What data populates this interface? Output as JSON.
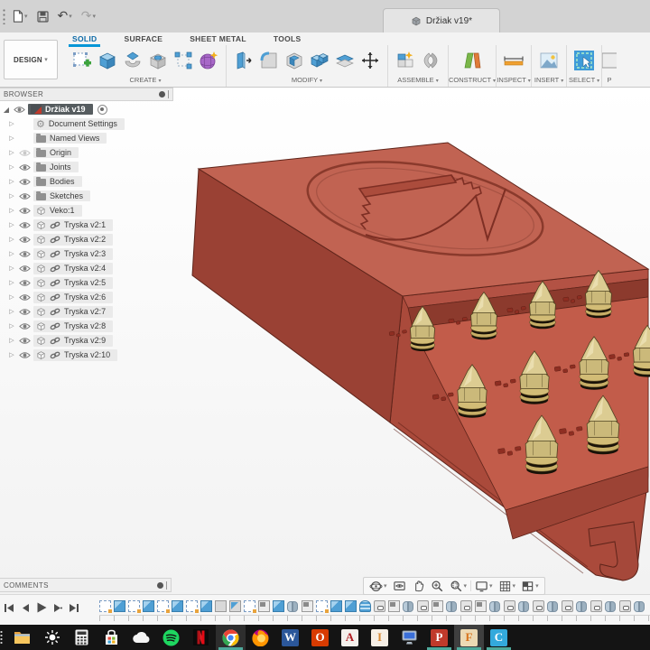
{
  "titlebar": {
    "document_tab": "Držiak v19*"
  },
  "ribbon": {
    "design_menu": "DESIGN",
    "tabs": [
      {
        "label": "SOLID",
        "active": true
      },
      {
        "label": "SURFACE",
        "active": false
      },
      {
        "label": "SHEET METAL",
        "active": false
      },
      {
        "label": "TOOLS",
        "active": false
      }
    ],
    "sections": [
      {
        "label": "CREATE",
        "tools": [
          "create-sketch",
          "extrude",
          "revolve",
          "hole",
          "rectangular-pattern",
          "create-form"
        ]
      },
      {
        "label": "MODIFY",
        "tools": [
          "press-pull",
          "fillet",
          "shell",
          "combine",
          "offset-face",
          "move"
        ]
      },
      {
        "label": "ASSEMBLE",
        "tools": [
          "new-component",
          "joint"
        ]
      },
      {
        "label": "CONSTRUCT",
        "tools": [
          "construction-plane"
        ]
      },
      {
        "label": "INSPECT",
        "tools": [
          "measure"
        ]
      },
      {
        "label": "INSERT",
        "tools": [
          "insert-image"
        ]
      },
      {
        "label": "SELECT",
        "tools": [
          "select"
        ]
      },
      {
        "label": "P",
        "tools": [
          "clipped-tool"
        ],
        "clipped": true
      }
    ]
  },
  "browser": {
    "header": "BROWSER",
    "root": {
      "label": "Držiak v19"
    },
    "items": [
      {
        "label": "Document Settings",
        "icon": "gear",
        "eye": "none"
      },
      {
        "label": "Named Views",
        "icon": "folder",
        "eye": "none"
      },
      {
        "label": "Origin",
        "icon": "folder",
        "eye": "dim"
      },
      {
        "label": "Joints",
        "icon": "folder",
        "eye": "on"
      },
      {
        "label": "Bodies",
        "icon": "folder",
        "eye": "on"
      },
      {
        "label": "Sketches",
        "icon": "folder",
        "eye": "on"
      },
      {
        "label": "Veko:1",
        "icon": "component",
        "eye": "on"
      },
      {
        "label": "Tryska v2:1",
        "icon": "component-link",
        "eye": "on"
      },
      {
        "label": "Tryska v2:2",
        "icon": "component-link",
        "eye": "on"
      },
      {
        "label": "Tryska v2:3",
        "icon": "component-link",
        "eye": "on"
      },
      {
        "label": "Tryska v2:4",
        "icon": "component-link",
        "eye": "on"
      },
      {
        "label": "Tryska v2:5",
        "icon": "component-link",
        "eye": "on"
      },
      {
        "label": "Tryska v2:6",
        "icon": "component-link",
        "eye": "on"
      },
      {
        "label": "Tryska v2:7",
        "icon": "component-link",
        "eye": "on"
      },
      {
        "label": "Tryska v2:8",
        "icon": "component-link",
        "eye": "on"
      },
      {
        "label": "Tryska v2:9",
        "icon": "component-link",
        "eye": "on"
      },
      {
        "label": "Tryska v2:10",
        "icon": "component-link",
        "eye": "on"
      }
    ]
  },
  "comments": {
    "label": "COMMENTS"
  },
  "timeline": {
    "features": [
      "sketch",
      "extrude",
      "sketch",
      "extrude",
      "sketch",
      "extrude",
      "sketch",
      "extrude",
      "body",
      "revolve",
      "sketch",
      "flag",
      "extrude",
      "joint",
      "flag",
      "sketch",
      "extrude",
      "extrude",
      "coil",
      "component",
      "flag",
      "joint",
      "component",
      "flag",
      "joint",
      "component",
      "flag",
      "joint",
      "component",
      "joint",
      "component",
      "joint",
      "component",
      "joint",
      "component",
      "joint",
      "component",
      "joint"
    ]
  },
  "viewport_nav": [
    {
      "name": "orbit",
      "dropdown": true
    },
    {
      "name": "look-at",
      "dropdown": false
    },
    {
      "name": "pan",
      "dropdown": false
    },
    {
      "name": "zoom",
      "dropdown": false
    },
    {
      "name": "fit",
      "dropdown": true
    },
    {
      "name": "display-settings",
      "dropdown": true
    },
    {
      "name": "grid-display",
      "dropdown": true
    },
    {
      "name": "viewports",
      "dropdown": true
    }
  ],
  "taskbar": {
    "apps": [
      {
        "name": "file-explorer",
        "running": false,
        "active": false,
        "highlight": false
      },
      {
        "name": "brightness",
        "running": false,
        "active": false,
        "highlight": false
      },
      {
        "name": "calculator",
        "running": false,
        "active": false,
        "highlight": false
      },
      {
        "name": "microsoft-store",
        "running": false,
        "active": false,
        "highlight": false
      },
      {
        "name": "onedrive",
        "running": false,
        "active": false,
        "highlight": false
      },
      {
        "name": "spotify",
        "running": false,
        "active": false,
        "highlight": false
      },
      {
        "name": "netflix",
        "running": false,
        "active": false,
        "highlight": false
      },
      {
        "name": "chrome",
        "running": true,
        "active": false,
        "highlight": true
      },
      {
        "name": "firefox",
        "running": false,
        "active": false,
        "highlight": false
      },
      {
        "name": "word",
        "running": false,
        "active": false,
        "highlight": false
      },
      {
        "name": "office",
        "running": false,
        "active": false,
        "highlight": false
      },
      {
        "name": "autocad",
        "running": false,
        "active": false,
        "highlight": false
      },
      {
        "name": "inventor",
        "running": false,
        "active": false,
        "highlight": false
      },
      {
        "name": "remote-desktop",
        "running": false,
        "active": false,
        "highlight": false
      },
      {
        "name": "pdf-reader",
        "running": true,
        "active": false,
        "highlight": false
      },
      {
        "name": "fusion-360",
        "running": true,
        "active": true,
        "highlight": true
      },
      {
        "name": "cura",
        "running": true,
        "active": false,
        "highlight": false
      }
    ]
  },
  "model": {
    "colors": {
      "body_top": "#c16352",
      "body_dark": "#9a4134",
      "body_front": "#aa4a3b",
      "tray_floor": "#c25c4a",
      "nozzle_brass": "#d8c78e"
    },
    "nozzle_count": 10
  }
}
